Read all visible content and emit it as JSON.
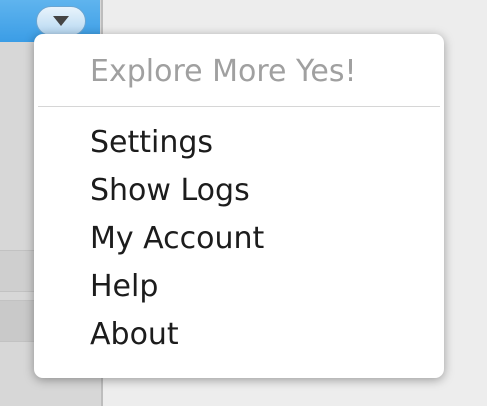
{
  "dropdown": {
    "header": "Explore More Yes!",
    "items": [
      {
        "id": "settings",
        "label": "Settings"
      },
      {
        "id": "show-logs",
        "label": "Show Logs"
      },
      {
        "id": "my-account",
        "label": "My Account"
      },
      {
        "id": "help",
        "label": "Help"
      },
      {
        "id": "about",
        "label": "About"
      }
    ]
  },
  "icons": {
    "dropdown_trigger": "chevron-down-icon"
  },
  "colors": {
    "accent": "#3b9de6",
    "menu_background": "#ffffff",
    "header_text": "#a0a0a0",
    "item_text": "#1c1c1c"
  }
}
